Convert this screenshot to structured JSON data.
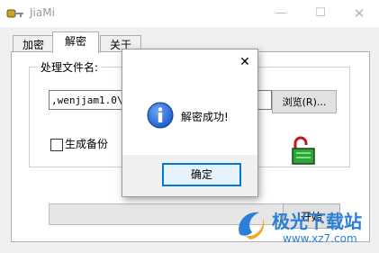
{
  "window": {
    "title": "JiaMi",
    "min_icon": "minimize-icon",
    "max_icon": "maximize-icon",
    "close_icon": "close-icon"
  },
  "tabs": [
    {
      "label": "加密",
      "selected": false
    },
    {
      "label": "解密",
      "selected": true
    },
    {
      "label": "关于",
      "selected": false
    }
  ],
  "decrypt_panel": {
    "group_label": "处理文件名:",
    "file_path": ",wenjjam1.0\\we",
    "browse_label": "浏览(R)...",
    "backup_label": "生成备份",
    "backup_checked": false,
    "lock_icon": "unlocked-padlock-icon",
    "start_label": "开始",
    "progress": 0
  },
  "dialog": {
    "message": "解密成功!",
    "ok_label": "确定",
    "icon": "info-icon"
  },
  "watermark": {
    "brand": "极光下载站",
    "url": "www.xz7.com"
  },
  "colors": {
    "accent": "#0078d7",
    "watermark": "#2b7fd6",
    "info_blue": "#1a56c4"
  }
}
